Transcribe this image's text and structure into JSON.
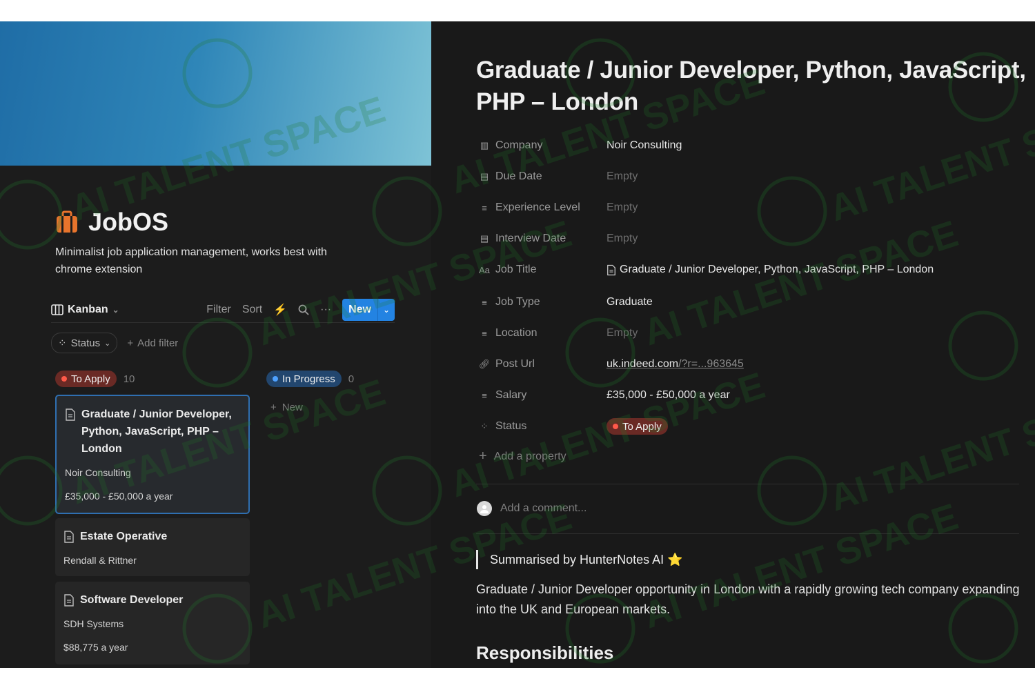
{
  "left": {
    "title": "JobOS",
    "description": "Minimalist job application management, works best with chrome extension",
    "view": {
      "label": "Kanban"
    },
    "toolbar": {
      "filter": "Filter",
      "sort": "Sort",
      "new": "New"
    },
    "filters": {
      "status": "Status",
      "add_filter": "Add filter"
    },
    "columns": [
      {
        "label": "To Apply",
        "count": "10",
        "color": "#c94c3e"
      },
      {
        "label": "In Progress",
        "count": "0",
        "color": "#2f6fb5",
        "new_label": "New"
      }
    ],
    "cards": [
      {
        "title": "Graduate / Junior Developer, Python, JavaScript, PHP – London",
        "company": "Noir Consulting",
        "salary": "£35,000 - £50,000 a year"
      },
      {
        "title": "Estate Operative",
        "company": "Rendall & Rittner"
      },
      {
        "title": "Software Developer",
        "company": "SDH Systems",
        "salary": "$88,775 a year"
      }
    ]
  },
  "right": {
    "title": "Graduate / Junior Developer, Python, JavaScript, PHP – London",
    "properties": {
      "company": {
        "label": "Company",
        "value": "Noir Consulting"
      },
      "due_date": {
        "label": "Due Date",
        "value": "Empty"
      },
      "experience": {
        "label": "Experience Level",
        "value": "Empty"
      },
      "interview": {
        "label": "Interview Date",
        "value": "Empty"
      },
      "job_title": {
        "label": "Job Title",
        "value": "Graduate / Junior Developer, Python, JavaScript, PHP – London"
      },
      "job_type": {
        "label": "Job Type",
        "value": "Graduate"
      },
      "location": {
        "label": "Location",
        "value": "Empty"
      },
      "post_url": {
        "label": "Post Url",
        "value_main": "uk.indeed.com",
        "value_rest": "/?r=...963645"
      },
      "salary": {
        "label": "Salary",
        "value": "£35,000 - £50,000 a year"
      },
      "status": {
        "label": "Status",
        "value": "To Apply"
      }
    },
    "add_property": "Add a property",
    "comment_placeholder": "Add a comment...",
    "summary_by": "Summarised by HunterNotes AI ⭐",
    "summary": "Graduate / Junior Developer opportunity in London with a rapidly growing tech company expanding into the UK and European markets.",
    "section_heading": "Responsibilities"
  },
  "watermark": {
    "text": "AI TALENT SPACE",
    "color": "#1f7a2a"
  },
  "colors": {
    "accent": "#2383e2",
    "to_apply": "#c94c3e",
    "in_progress": "#2f6fb5"
  }
}
